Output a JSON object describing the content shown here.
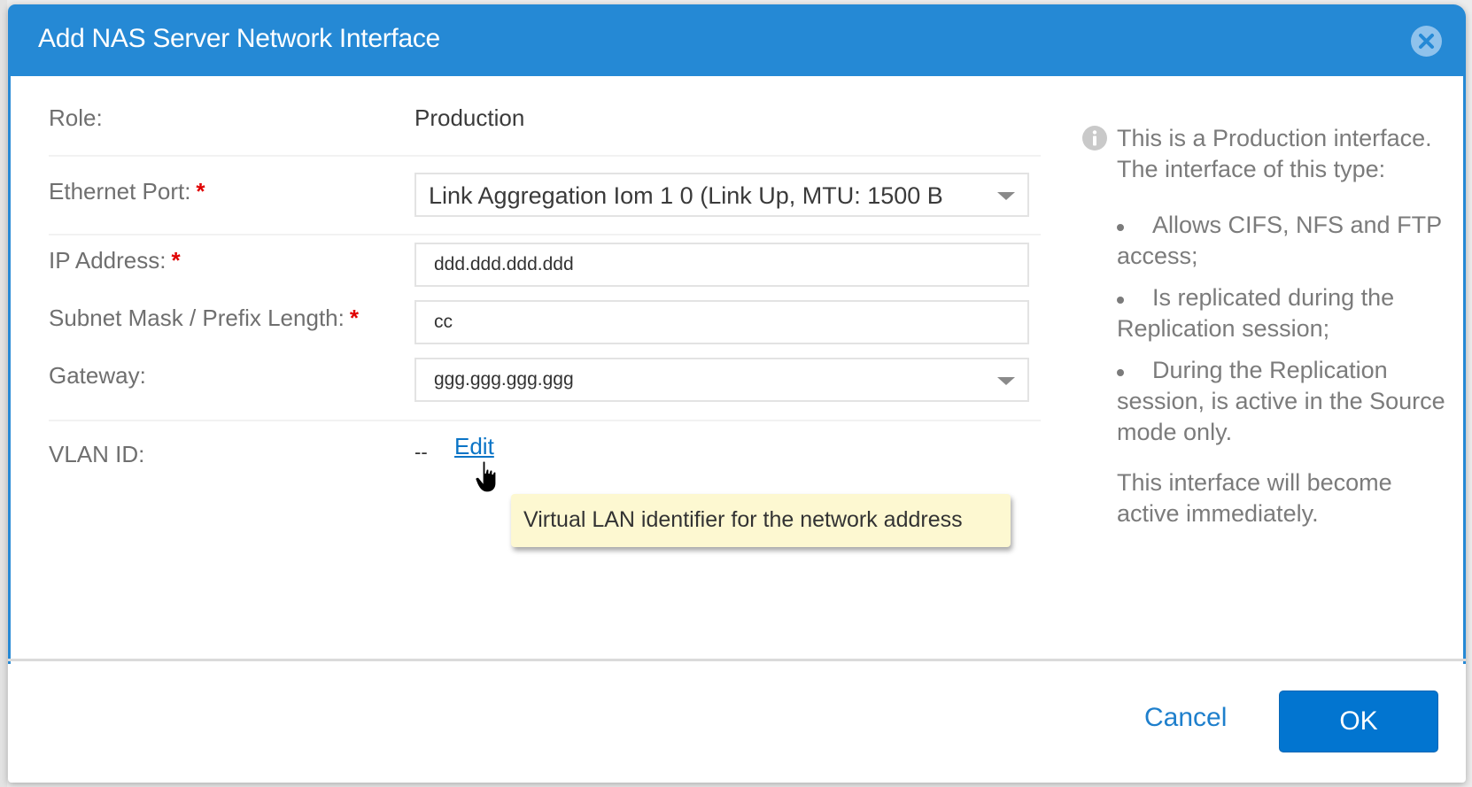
{
  "dialog": {
    "title": "Add NAS Server Network Interface",
    "close_icon": "close-circle-icon",
    "colors": {
      "header": "#2589d5",
      "accent": "#0275d0",
      "link": "#0a74c6",
      "required": "#e00000",
      "tooltip_bg": "#fdf8d1"
    }
  },
  "form": {
    "role": {
      "label": "Role:",
      "value": "Production"
    },
    "ethernet_port": {
      "label": "Ethernet Port:",
      "required_mark": "*",
      "value": "Link Aggregation Iom 1 0 (Link Up, MTU: 1500 B"
    },
    "ip_address": {
      "label": "IP Address:",
      "required_mark": "*",
      "value": "ddd.ddd.ddd.ddd"
    },
    "subnet": {
      "label": "Subnet Mask / Prefix Length:",
      "required_mark": "*",
      "value": "cc"
    },
    "gateway": {
      "label": "Gateway:",
      "value": "ggg.ggg.ggg.ggg"
    },
    "vlan": {
      "label": "VLAN ID:",
      "value": "--",
      "edit_label": "Edit"
    }
  },
  "tooltip": {
    "text": "Virtual LAN identifier for the network address"
  },
  "info": {
    "icon": "info-icon",
    "intro": "This is a Production interface. The interface of this type:",
    "bullets": [
      "Allows CIFS, NFS and FTP access;",
      "Is replicated during the Replication session;",
      "During the Replication session, is active in the Source mode only."
    ],
    "outro": "This interface will become active immediately."
  },
  "footer": {
    "cancel_label": "Cancel",
    "ok_label": "OK"
  }
}
